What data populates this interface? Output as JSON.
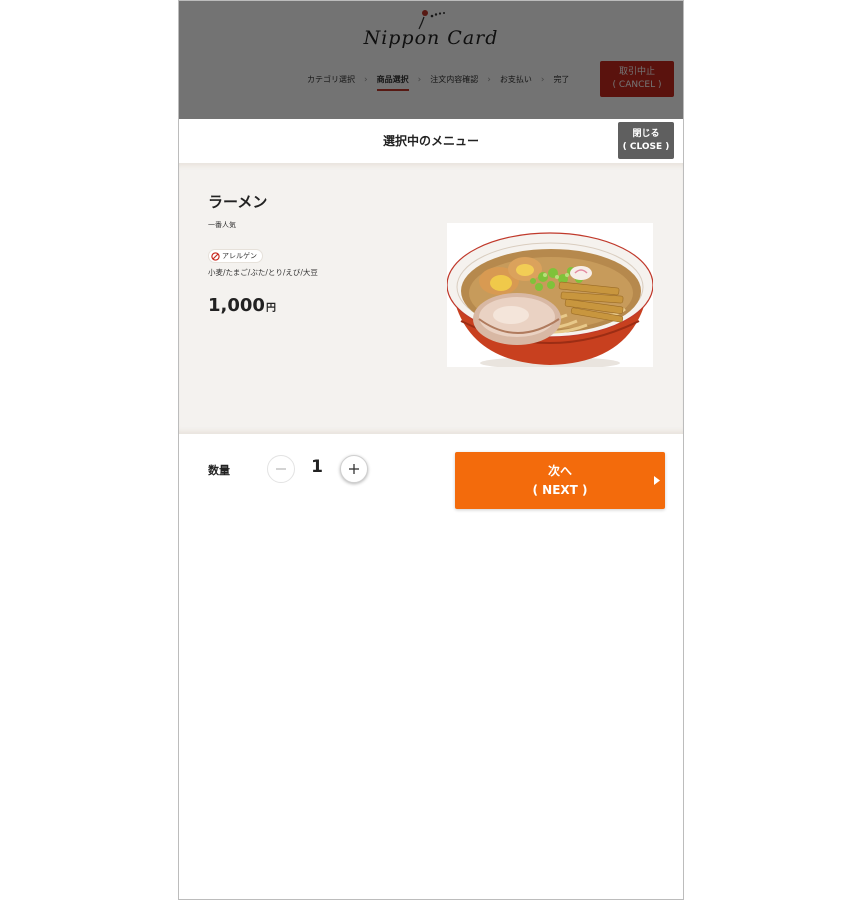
{
  "header": {
    "logo_text": "Nippon Card",
    "steps": [
      {
        "label": "カテゴリ選択",
        "active": false
      },
      {
        "label": "商品選択",
        "active": true
      },
      {
        "label": "注文内容確認",
        "active": false
      },
      {
        "label": "お支払い",
        "active": false
      },
      {
        "label": "完了",
        "active": false
      }
    ],
    "cancel_label": "取引中止",
    "cancel_sub": "( CANCEL )"
  },
  "modal": {
    "title": "選択中のメニュー",
    "close_label": "閉じる",
    "close_sub": "( CLOSE )"
  },
  "item": {
    "name": "ラーメン",
    "tag": "一番人気",
    "allergy_badge": "アレルゲン",
    "allergens": "小麦/たまご/ぶた/とり/えび/大豆",
    "price": "1,000",
    "price_unit": "円",
    "image": "ramen-photo"
  },
  "quantity": {
    "label": "数量",
    "value": "1"
  },
  "next": {
    "label": "次へ",
    "sub": "( NEXT )"
  },
  "colors": {
    "accent": "#f36b0c",
    "cancel": "#c8281e",
    "close": "#5f5f5f",
    "detail_bg": "#f4f2ef"
  }
}
